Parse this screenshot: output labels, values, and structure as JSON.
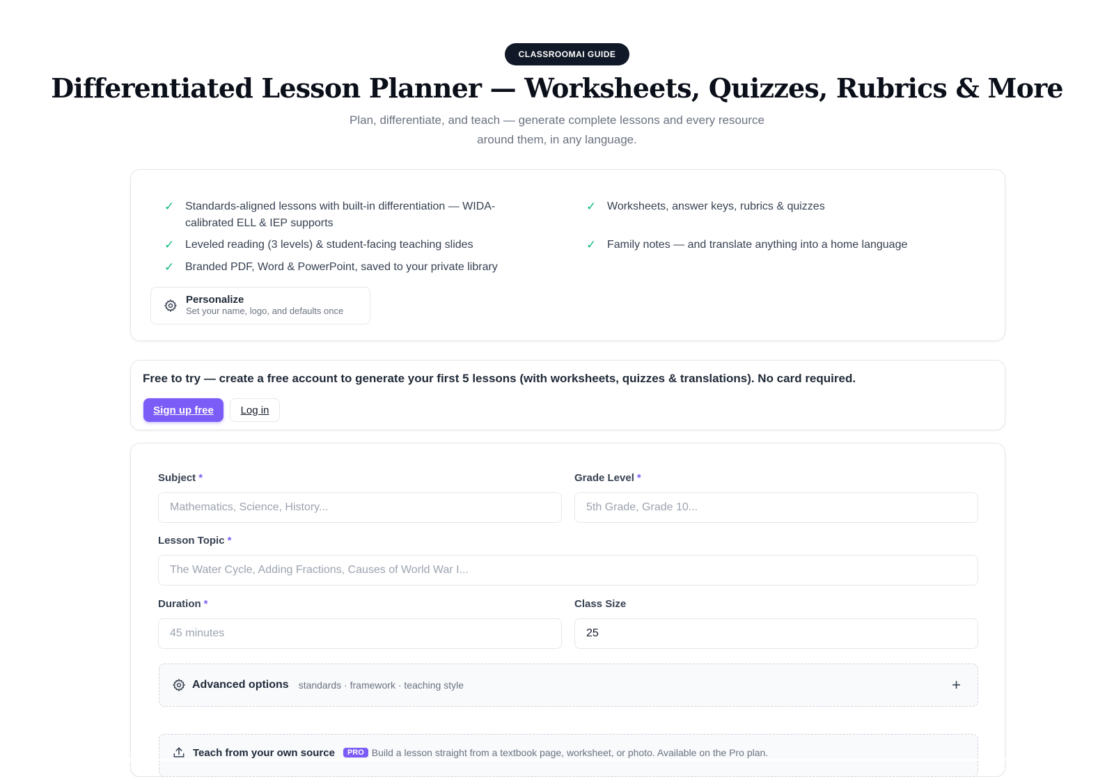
{
  "header": {
    "badge": "CLASSROOMAI GUIDE",
    "title": "Differentiated Lesson Planner — Worksheets, Quizzes, Rubrics & More",
    "subtitle": "Plan, differentiate, and teach — generate complete lessons and every resource around them, in any language."
  },
  "features": {
    "items": [
      "Standards-aligned lessons with built-in differentiation — WIDA-calibrated ELL & IEP supports",
      "Worksheets, answer keys, rubrics & quizzes",
      "Leveled reading (3 levels) & student-facing teaching slides",
      "Family notes — and translate anything into a home language",
      "Branded PDF, Word & PowerPoint, saved to your private library"
    ],
    "check_icon": "check-icon",
    "personalize": {
      "title": "Personalize",
      "subtitle": "Set your name, logo, and defaults once",
      "icon": "gear-icon"
    }
  },
  "signup": {
    "message": "Free to try — create a free account to generate your first 5 lessons (with worksheets, quizzes & translations). No card required.",
    "signup_label": "Sign up free",
    "login_label": "Log in"
  },
  "form": {
    "required_marker": "*",
    "subject": {
      "label": "Subject",
      "placeholder": "Mathematics, Science, History...",
      "value": ""
    },
    "grade": {
      "label": "Grade Level",
      "placeholder": "5th Grade, Grade 10...",
      "value": ""
    },
    "topic": {
      "label": "Lesson Topic",
      "placeholder": "The Water Cycle, Adding Fractions, Causes of World War I...",
      "value": ""
    },
    "duration": {
      "label": "Duration",
      "placeholder": "45 minutes",
      "value": ""
    },
    "class_size": {
      "label": "Class Size",
      "placeholder": "",
      "value": "25"
    },
    "advanced": {
      "title": "Advanced options",
      "subtitle": "standards · framework · teaching style",
      "toggle": "+"
    },
    "source": {
      "title": "Teach from your own source",
      "badge": "PRO",
      "subtitle": "Build a lesson straight from a textbook page, worksheet, or photo. Available on the Pro plan."
    }
  },
  "colors": {
    "accent": "#7c5cf6",
    "check": "#10b981",
    "badge_bg": "#111827"
  }
}
